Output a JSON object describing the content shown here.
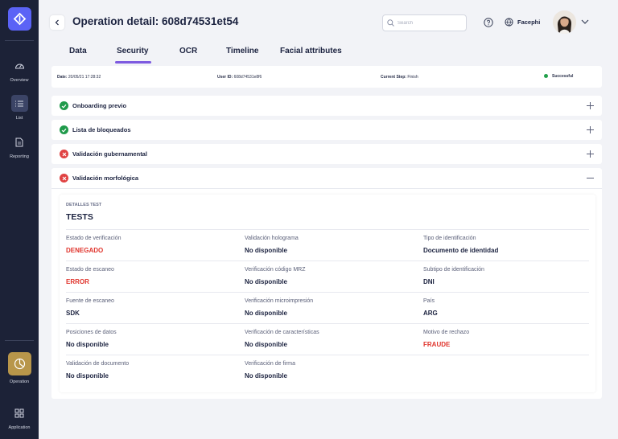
{
  "sidebar": {
    "items": [
      {
        "label": "Overview",
        "icon": "speedometer-icon"
      },
      {
        "label": "List",
        "icon": "list-icon",
        "active": true
      },
      {
        "label": "Reporting",
        "icon": "document-icon"
      }
    ],
    "bottom": [
      {
        "label": "Operation",
        "icon": "pie-chart-icon",
        "active": true
      },
      {
        "label": "Application",
        "icon": "grid-icon"
      }
    ]
  },
  "header": {
    "title": "Operation detail: 608d74531et54",
    "search_placeholder": "Search",
    "user_name": "Facephi"
  },
  "tabs": [
    "Data",
    "Security",
    "OCR",
    "Timeline",
    "Facial attributes"
  ],
  "active_tab": "Security",
  "infobar": {
    "date_label": "Date:",
    "date_value": "20/05/21 17:28:32",
    "user_label": "User ID:",
    "user_value": "608d74531e8f6",
    "step_label": "Current Step:",
    "step_value": "Finish",
    "status": "Successful",
    "status_color": "#22a04b"
  },
  "accordions": [
    {
      "title": "Onboarding previo",
      "status": "ok",
      "expanded": false
    },
    {
      "title": "Lista de bloqueados",
      "status": "ok",
      "expanded": false
    },
    {
      "title": "Validación gubernamental",
      "status": "error",
      "expanded": false
    },
    {
      "title": "Validación morfológica",
      "status": "error",
      "expanded": true
    }
  ],
  "details": {
    "section_label": "DETALLES TEST",
    "title": "TESTS",
    "fields": [
      {
        "label": "Estado de verificación",
        "value": "DENEGADO",
        "alert": true
      },
      {
        "label": "Validación holograma",
        "value": "No disponible"
      },
      {
        "label": "Tipo de identificación",
        "value": "Documento de identidad"
      },
      {
        "label": "Estado de escaneo",
        "value": "ERROR",
        "alert": true
      },
      {
        "label": "Verificación código MRZ",
        "value": "No disponible"
      },
      {
        "label": "Subtipo de identificación",
        "value": "DNI"
      },
      {
        "label": "Fuente de escaneo",
        "value": "SDK"
      },
      {
        "label": "Verificación microimpresión",
        "value": "No disponible"
      },
      {
        "label": "País",
        "value": "ARG"
      },
      {
        "label": "Posiciones de datos",
        "value": "No disponible"
      },
      {
        "label": "Verificación de características",
        "value": "No disponible"
      },
      {
        "label": "Motivo de rechazo",
        "value": "FRAUDE",
        "alert": true
      },
      {
        "label": "Validación de documento",
        "value": "No disponible"
      },
      {
        "label": "Verificación de firma",
        "value": "No disponible"
      }
    ]
  },
  "colors": {
    "accent": "#7d5ae0",
    "error": "#e0342c",
    "success": "#1f9a4a",
    "sidebar": "#1c2237",
    "operation": "#b8964a"
  }
}
